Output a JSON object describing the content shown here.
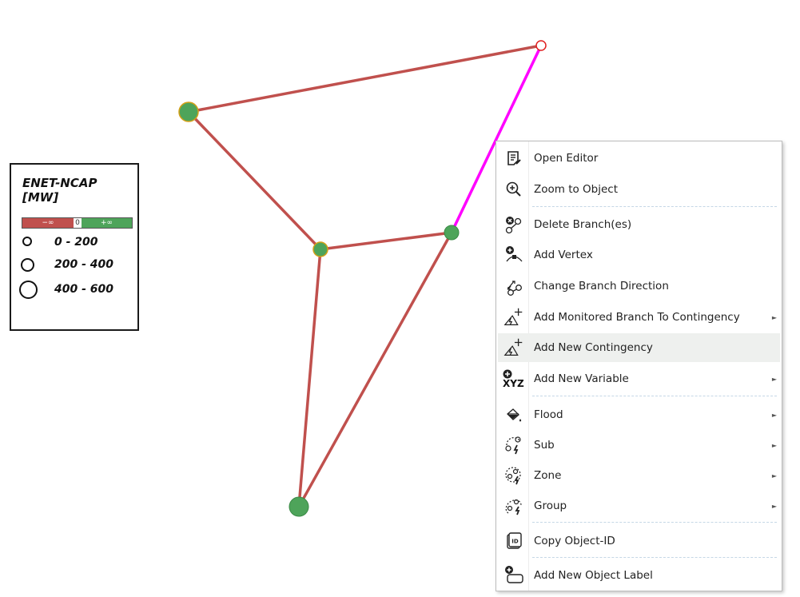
{
  "legend": {
    "title_line1": "ENET-NCAP",
    "title_line2": "[MW]",
    "scale": {
      "neg": "−∞",
      "zero": "0",
      "pos": "+∞"
    },
    "ranges": [
      "0 - 200",
      "200 - 400",
      "400 - 600"
    ]
  },
  "network": {
    "line_color": "#c0504d",
    "selected_color": "#ff00ff",
    "node_color": "#4ea45a"
  },
  "menu": {
    "items": [
      {
        "label": "Open Editor",
        "icon": "editor-icon",
        "submenu": false
      },
      {
        "label": "Zoom to Object",
        "icon": "zoom-in-icon",
        "submenu": false
      },
      {
        "label": "Delete Branch(es)",
        "icon": "delete-branch-icon",
        "submenu": false
      },
      {
        "label": "Add Vertex",
        "icon": "add-vertex-icon",
        "submenu": false
      },
      {
        "label": "Change Branch Direction",
        "icon": "change-direction-icon",
        "submenu": false
      },
      {
        "label": "Add Monitored Branch To Contingency",
        "icon": "contingency-add-icon",
        "submenu": true
      },
      {
        "label": "Add New Contingency",
        "icon": "contingency-add-icon",
        "submenu": false,
        "highlighted": true
      },
      {
        "label": "Add New Variable",
        "icon": "xyz-add-icon",
        "submenu": true
      },
      {
        "label": "Flood",
        "icon": "flood-fill-icon",
        "submenu": true
      },
      {
        "label": "Sub",
        "icon": "sub-icon",
        "submenu": true
      },
      {
        "label": "Zone",
        "icon": "zone-icon",
        "submenu": true
      },
      {
        "label": "Group",
        "icon": "group-icon",
        "submenu": true
      },
      {
        "label": "Copy Object-ID",
        "icon": "id-icon",
        "submenu": false
      },
      {
        "label": "Add New Object Label",
        "icon": "add-label-icon",
        "submenu": false
      }
    ],
    "xyz_glyph": "XYZ",
    "id_glyph": "ID"
  }
}
